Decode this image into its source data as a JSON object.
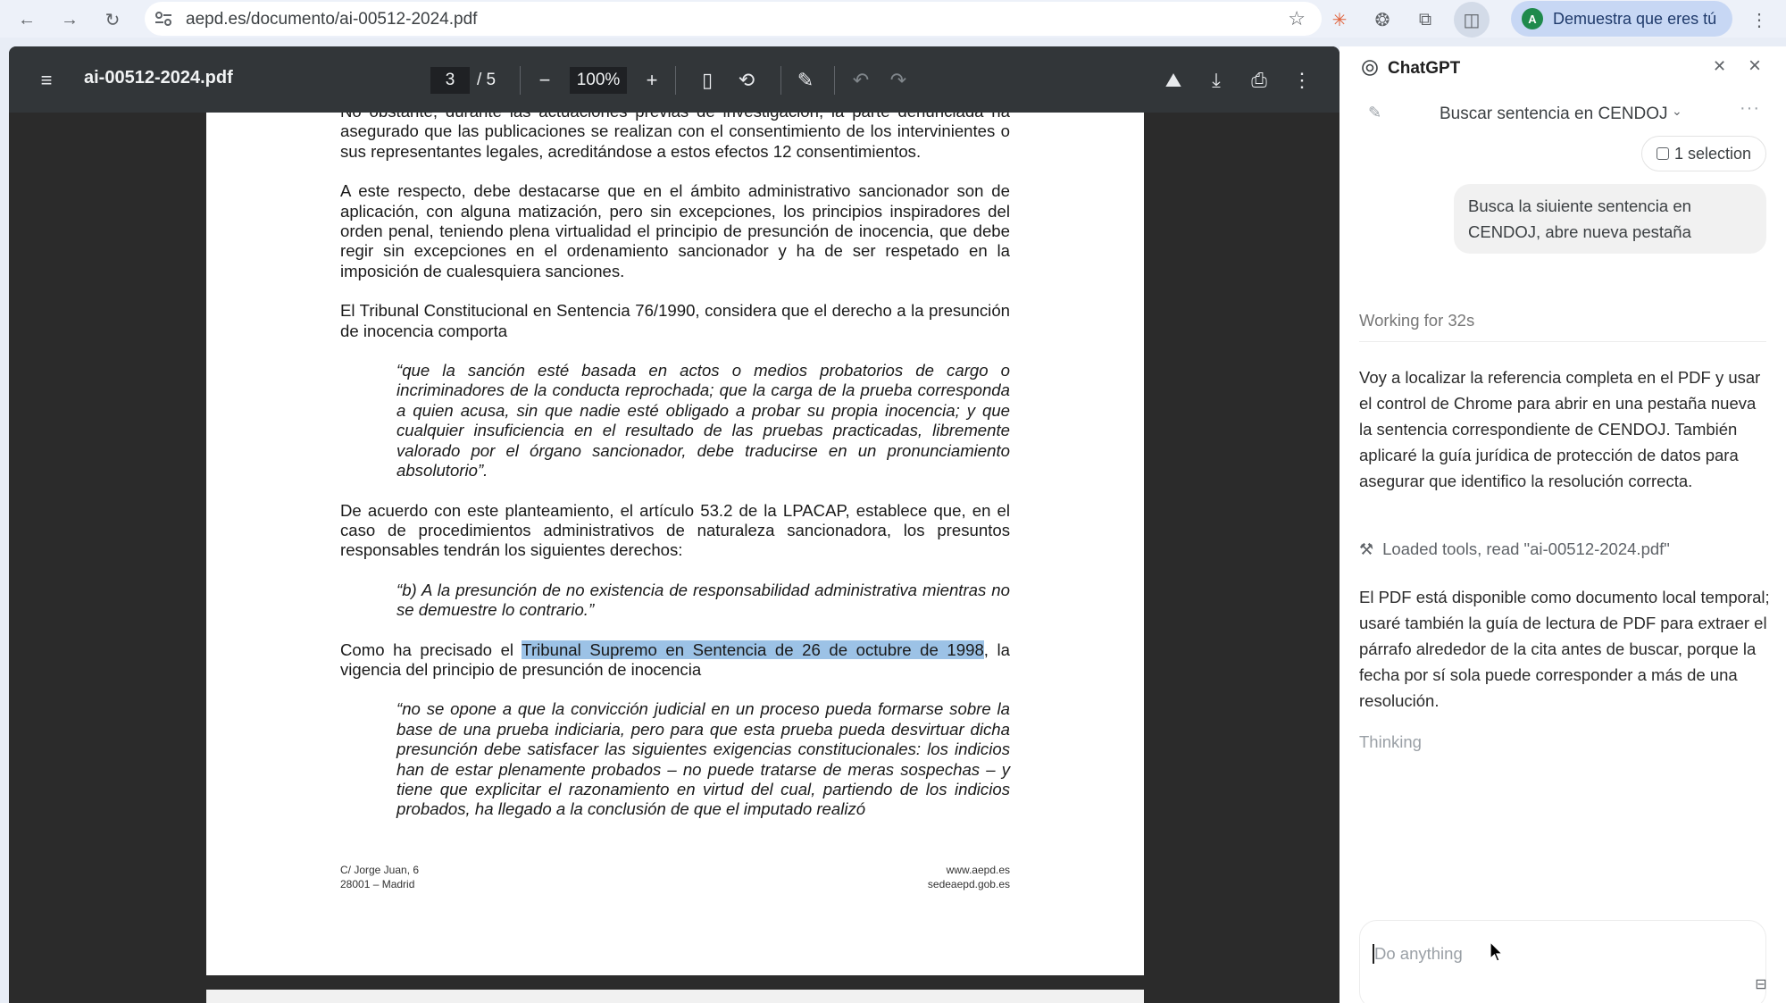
{
  "browser": {
    "url": "aepd.es/documento/ai-00512-2024.pdf",
    "profile_label": "Demuestra que eres tú",
    "profile_initial": "A"
  },
  "pdf": {
    "filename": "ai-00512-2024.pdf",
    "current_page": "3",
    "total_pages": "/ 5",
    "zoom": "100%",
    "paragraphs": {
      "p0": "No obstante, durante las actuaciones previas de investigación, la parte denunciada ha asegurado que las publicaciones se realizan con el consentimiento de los intervinientes o sus representantes legales, acreditándose a estos efectos 12 consentimientos.",
      "p1": "A este respecto, debe destacarse que en el ámbito administrativo sancionador son de aplicación, con alguna matización, pero sin excepciones, los principios inspiradores del orden penal, teniendo plena virtualidad el principio de presunción de inocencia, que debe regir sin excepciones en el ordenamiento sancionador y ha de ser respetado en la imposición de cualesquiera sanciones.",
      "p2": "El Tribunal Constitucional en Sentencia 76/1990, considera que el derecho a la presunción de inocencia comporta",
      "q1": "“que la sanción esté basada en actos o medios probatorios de cargo o incriminadores de la conducta reprochada; que la carga de la prueba corresponda a quien acusa, sin que nadie esté obligado a probar su propia inocencia; y que cualquier insuficiencia en el resultado de las pruebas practicadas, libremente valorado por el órgano sancionador, debe traducirse en un pronunciamiento absolutorio”.",
      "p3": "De acuerdo con este planteamiento, el artículo 53.2 de la LPACAP, establece que, en el caso de procedimientos administrativos de naturaleza sancionadora, los presuntos responsables tendrán los siguientes derechos:",
      "q2": "“b) A la presunción de no existencia de responsabilidad administrativa mientras no se demuestre lo contrario.”",
      "p4_pre": "Como ha precisado el ",
      "p4_highlight": "Tribunal Supremo en Sentencia de 26 de octubre de 1998",
      "p4_post": ", la vigencia del principio de presunción de inocencia",
      "q3": "“no se opone a que la convicción judicial en un proceso pueda formarse sobre la base de una prueba indiciaria, pero para que esta prueba pueda desvirtuar dicha presunción debe satisfacer las siguientes exigencias constitucionales: los indicios han de estar plenamente probados – no puede tratarse de meras sospechas – y tiene que explicitar el razonamiento en virtud del cual, partiendo de los indicios probados, ha llegado a la conclusión de que el imputado realizó"
    },
    "footer": {
      "address1": "C/ Jorge Juan, 6",
      "address2": "28001 – Madrid",
      "web1": "www.aepd.es",
      "web2": "sedeaepd.gob.es"
    }
  },
  "chat": {
    "title": "ChatGPT",
    "conversation_title": "Buscar sentencia en CENDOJ",
    "selection_chip": "1 selection",
    "user_message": "Busca la siuiente sentencia en CENDOJ, abre nueva pestaña",
    "status": "Working for 32s",
    "reply1": "Voy a localizar la referencia completa en el PDF y usar el control de Chrome para abrir en una pestaña nueva la sentencia correspondiente de CENDOJ. También aplicaré la guía jurídica de protección de datos para asegurar que identifico la resolución correcta.",
    "tool_line": "Loaded tools, read \"ai-00512-2024.pdf\"",
    "reply2": "El PDF está disponible como documento local temporal; usaré también la guía de lectura de PDF para extraer el párrafo alrededor de la cita antes de buscar, porque la fecha por sí sola puede corresponder a más de una resolución.",
    "thinking": "Thinking",
    "composer_placeholder": "Do anything"
  }
}
